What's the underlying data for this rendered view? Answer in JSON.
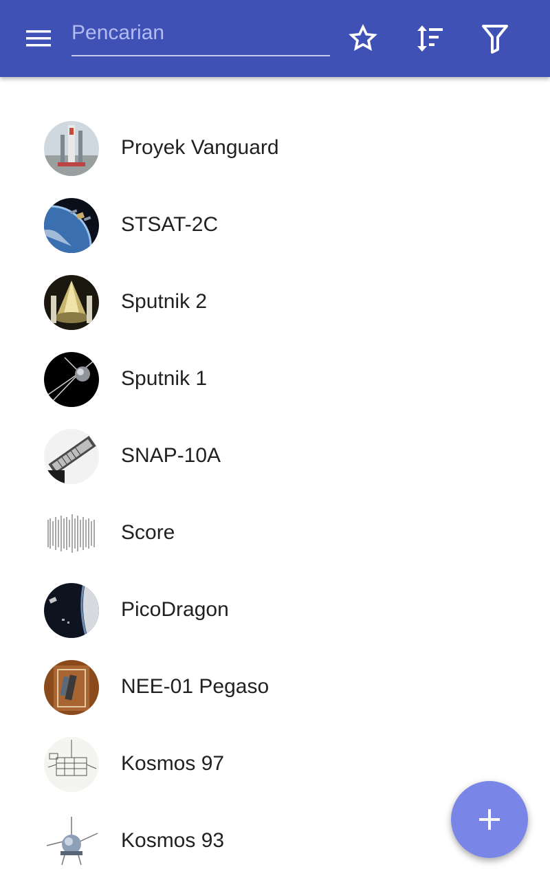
{
  "toolbar": {
    "search_placeholder": "Pencarian",
    "background_color": "#3f51b5",
    "menu_icon": "hamburger-menu-icon",
    "favorites_icon": "star-outline-icon",
    "sort_icon": "sort-icon",
    "filter_icon": "filter-icon"
  },
  "list": {
    "items": [
      {
        "label": "Proyek Vanguard",
        "thumbnail": "rocket-launch-pad"
      },
      {
        "label": "STSAT-2C",
        "thumbnail": "satellite-over-earth"
      },
      {
        "label": "Sputnik 2",
        "thumbnail": "sputnik-2-capsule"
      },
      {
        "label": "Sputnik 1",
        "thumbnail": "sputnik-1-sphere"
      },
      {
        "label": "SNAP-10A",
        "thumbnail": "snap-10a-satellite"
      },
      {
        "label": "Score",
        "thumbnail": "score-logo-text"
      },
      {
        "label": "PicoDragon",
        "thumbnail": "picodragon-in-orbit"
      },
      {
        "label": "NEE-01 Pegaso",
        "thumbnail": "pegaso-satellite-display"
      },
      {
        "label": "Kosmos 97",
        "thumbnail": "kosmos-97-drawing"
      },
      {
        "label": "Kosmos 93",
        "thumbnail": "kosmos-93-satellite"
      }
    ]
  },
  "fab": {
    "icon": "plus-icon",
    "color": "#7986e8"
  }
}
